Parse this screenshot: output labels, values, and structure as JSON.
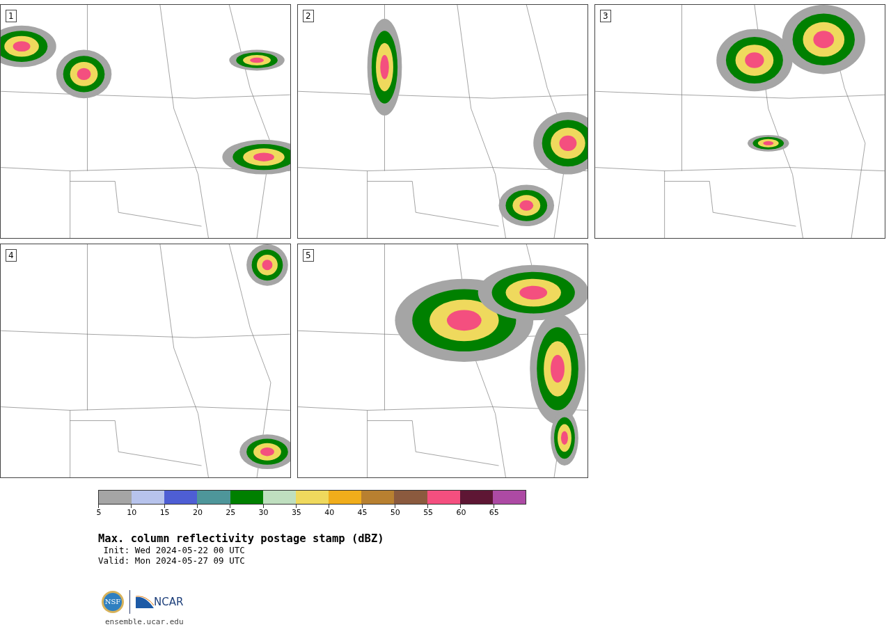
{
  "panels": [
    {
      "label": "1"
    },
    {
      "label": "2"
    },
    {
      "label": "3"
    },
    {
      "label": "4"
    },
    {
      "label": "5"
    }
  ],
  "colorbar": {
    "bins": [
      {
        "color": "#a5a5a5"
      },
      {
        "color": "#b7c3ec"
      },
      {
        "color": "#4e5ed4"
      },
      {
        "color": "#4e969a"
      },
      {
        "color": "#008000"
      },
      {
        "color": "#bfdfbf"
      },
      {
        "color": "#efd95d"
      },
      {
        "color": "#f0ad1b"
      },
      {
        "color": "#b88030"
      },
      {
        "color": "#8b5a3e"
      },
      {
        "color": "#f44f7f"
      },
      {
        "color": "#5e1634"
      },
      {
        "color": "#ad4aa4"
      }
    ],
    "ticks": [
      "5",
      "10",
      "15",
      "20",
      "25",
      "30",
      "35",
      "40",
      "45",
      "50",
      "55",
      "60",
      "65"
    ]
  },
  "title": "Max. column reflectivity postage stamp (dBZ)",
  "init": " Init: Wed 2024-05-22 00 UTC",
  "valid": "Valid: Mon 2024-05-27 09 UTC",
  "logos": {
    "nsf": "NSF",
    "ncar": "NCAR"
  },
  "url": "ensemble.ucar.edu"
}
